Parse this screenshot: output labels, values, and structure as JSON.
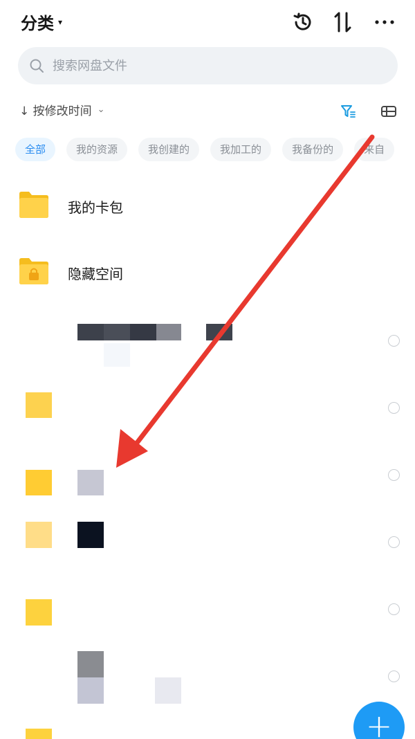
{
  "header": {
    "title": "分类",
    "caret": "▾"
  },
  "search": {
    "placeholder": "搜索网盘文件"
  },
  "sort": {
    "label": "↓ 按修改时间",
    "chevron": "⌄"
  },
  "chips": [
    {
      "label": "全部",
      "active": true
    },
    {
      "label": "我的资源"
    },
    {
      "label": "我创建的"
    },
    {
      "label": "我加工的"
    },
    {
      "label": "我备份的"
    },
    {
      "label": "来自"
    }
  ],
  "folders": [
    {
      "name": "我的卡包",
      "icon": "folder-icon"
    },
    {
      "name": "隐藏空间",
      "icon": "locked-folder-icon"
    }
  ],
  "fab": {
    "label": "+"
  },
  "colors": {
    "accent": "#1e9bf5",
    "folder_yellow": "#ffd24a",
    "annotation_arrow": "#e8392f"
  }
}
